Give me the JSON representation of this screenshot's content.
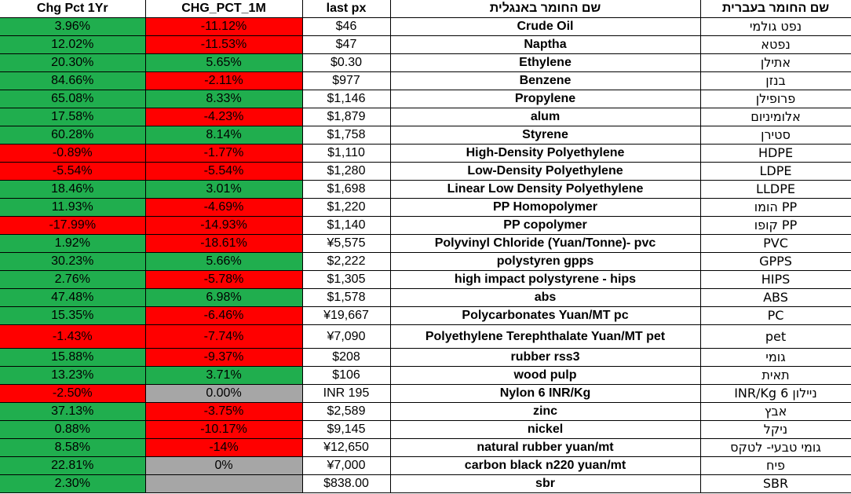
{
  "headers": {
    "chg_1yr": "Chg Pct 1Yr",
    "chg_1m": "CHG_PCT_1M",
    "last_px": "last px",
    "name_en": "שם החומר באנגלית",
    "name_he": "שם החומר בעברית"
  },
  "colors": {
    "positive": "#20ae4e",
    "negative": "#ff0000",
    "neutral": "#a6a6a6"
  },
  "rows": [
    {
      "chg_1yr": "3.96%",
      "chg_1m": "-11.12%",
      "last_px": "$46",
      "name_en": "Crude Oil",
      "name_he": "נפט גולמי"
    },
    {
      "chg_1yr": "12.02%",
      "chg_1m": "-11.53%",
      "last_px": "$47",
      "name_en": "Naptha",
      "name_he": "נפטא"
    },
    {
      "chg_1yr": "20.30%",
      "chg_1m": "5.65%",
      "last_px": "$0.30",
      "name_en": "Ethylene",
      "name_he": "אתילן"
    },
    {
      "chg_1yr": "84.66%",
      "chg_1m": "-2.11%",
      "last_px": "$977",
      "name_en": "Benzene",
      "name_he": "בנזן"
    },
    {
      "chg_1yr": "65.08%",
      "chg_1m": "8.33%",
      "last_px": "$1,146",
      "name_en": "Propylene",
      "name_he": "פרופילן"
    },
    {
      "chg_1yr": "17.58%",
      "chg_1m": "-4.23%",
      "last_px": "$1,879",
      "name_en": "alum",
      "name_he": "אלומיניום"
    },
    {
      "chg_1yr": "60.28%",
      "chg_1m": "8.14%",
      "last_px": "$1,758",
      "name_en": "Styrene",
      "name_he": "סטירן"
    },
    {
      "chg_1yr": "-0.89%",
      "chg_1m": "-1.77%",
      "last_px": "$1,110",
      "name_en": "High-Density Polyethylene",
      "name_he": "HDPE"
    },
    {
      "chg_1yr": "-5.54%",
      "chg_1m": "-5.54%",
      "last_px": "$1,280",
      "name_en": "Low-Density Polyethylene",
      "name_he": "LDPE"
    },
    {
      "chg_1yr": "18.46%",
      "chg_1m": "3.01%",
      "last_px": "$1,698",
      "name_en": "Linear Low Density Polyethylene",
      "name_he": "LLDPE"
    },
    {
      "chg_1yr": "11.93%",
      "chg_1m": "-4.69%",
      "last_px": "$1,220",
      "name_en": "PP Homopolymer",
      "name_he": "PP הומו"
    },
    {
      "chg_1yr": "-17.99%",
      "chg_1m": "-14.93%",
      "last_px": "$1,140",
      "name_en": "PP copolymer",
      "name_he": "PP קופו"
    },
    {
      "chg_1yr": "1.92%",
      "chg_1m": "-18.61%",
      "last_px": "¥5,575",
      "name_en": "Polyvinyl Chloride  (Yuan/Tonne)- pvc",
      "name_he": "PVC"
    },
    {
      "chg_1yr": "30.23%",
      "chg_1m": "5.66%",
      "last_px": "$2,222",
      "name_en": "polystyren gpps",
      "name_he": "GPPS"
    },
    {
      "chg_1yr": "2.76%",
      "chg_1m": "-5.78%",
      "last_px": "$1,305",
      "name_en": "high impact polystyrene - hips",
      "name_he": "HIPS"
    },
    {
      "chg_1yr": "47.48%",
      "chg_1m": "6.98%",
      "last_px": "$1,578",
      "name_en": "abs",
      "name_he": "ABS"
    },
    {
      "chg_1yr": "15.35%",
      "chg_1m": "-6.46%",
      "last_px": "¥19,667",
      "name_en": "Polycarbonates   Yuan/MT pc",
      "name_he": "PC"
    },
    {
      "chg_1yr": "-1.43%",
      "chg_1m": "-7.74%",
      "last_px": "¥7,090",
      "name_en": "Polyethylene Terephthalate  Yuan/MT pet",
      "name_he": "pet"
    },
    {
      "chg_1yr": "15.88%",
      "chg_1m": "-9.37%",
      "last_px": "$208",
      "name_en": "rubber rss3",
      "name_he": "גומי"
    },
    {
      "chg_1yr": "13.23%",
      "chg_1m": "3.71%",
      "last_px": "$106",
      "name_en": "wood pulp",
      "name_he": "תאית"
    },
    {
      "chg_1yr": "-2.50%",
      "chg_1m": "0.00%",
      "last_px": "INR 195",
      "name_en": "Nylon 6  INR/Kg",
      "name_he": "ניילון 6 INR/Kg"
    },
    {
      "chg_1yr": "37.13%",
      "chg_1m": "-3.75%",
      "last_px": "$2,589",
      "name_en": "zinc",
      "name_he": "אבץ"
    },
    {
      "chg_1yr": "0.88%",
      "chg_1m": "-10.17%",
      "last_px": "$9,145",
      "name_en": "nickel",
      "name_he": "ניקל"
    },
    {
      "chg_1yr": "8.58%",
      "chg_1m": "-14%",
      "last_px": "¥12,650",
      "name_en": "natural rubber yuan/mt",
      "name_he": "גומי טבעי- לטקס"
    },
    {
      "chg_1yr": "22.81%",
      "chg_1m": "0%",
      "last_px": "¥7,000",
      "name_en": "carbon black n220 yuan/mt",
      "name_he": "פיח"
    },
    {
      "chg_1yr": "2.30%",
      "chg_1m": "",
      "last_px": "$838.00",
      "name_en": "sbr",
      "name_he": "SBR"
    }
  ]
}
